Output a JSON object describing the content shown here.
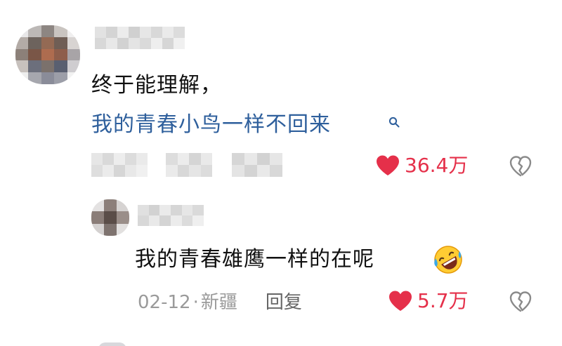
{
  "comments": [
    {
      "text_line1": "终于能理解，",
      "text_line2": "我的青春小鸟一样不回来",
      "likes": "36.4万"
    }
  ],
  "reply": {
    "text": "我的青春雄鹰一样的在呢",
    "date": "02-12",
    "separator": "·",
    "location": "新疆",
    "reply_label": "回复",
    "likes": "5.7万"
  },
  "icons": {
    "like": "heart-icon",
    "dislike": "broken-heart-icon",
    "search": "search-icon",
    "emoji": "rolling-on-floor-laughing-emoji"
  },
  "colors": {
    "like_red": "#e5304a",
    "link_blue": "#2e5f9c",
    "meta_gray": "#9a9a9a",
    "dislike_gray": "#8a8a8a"
  }
}
